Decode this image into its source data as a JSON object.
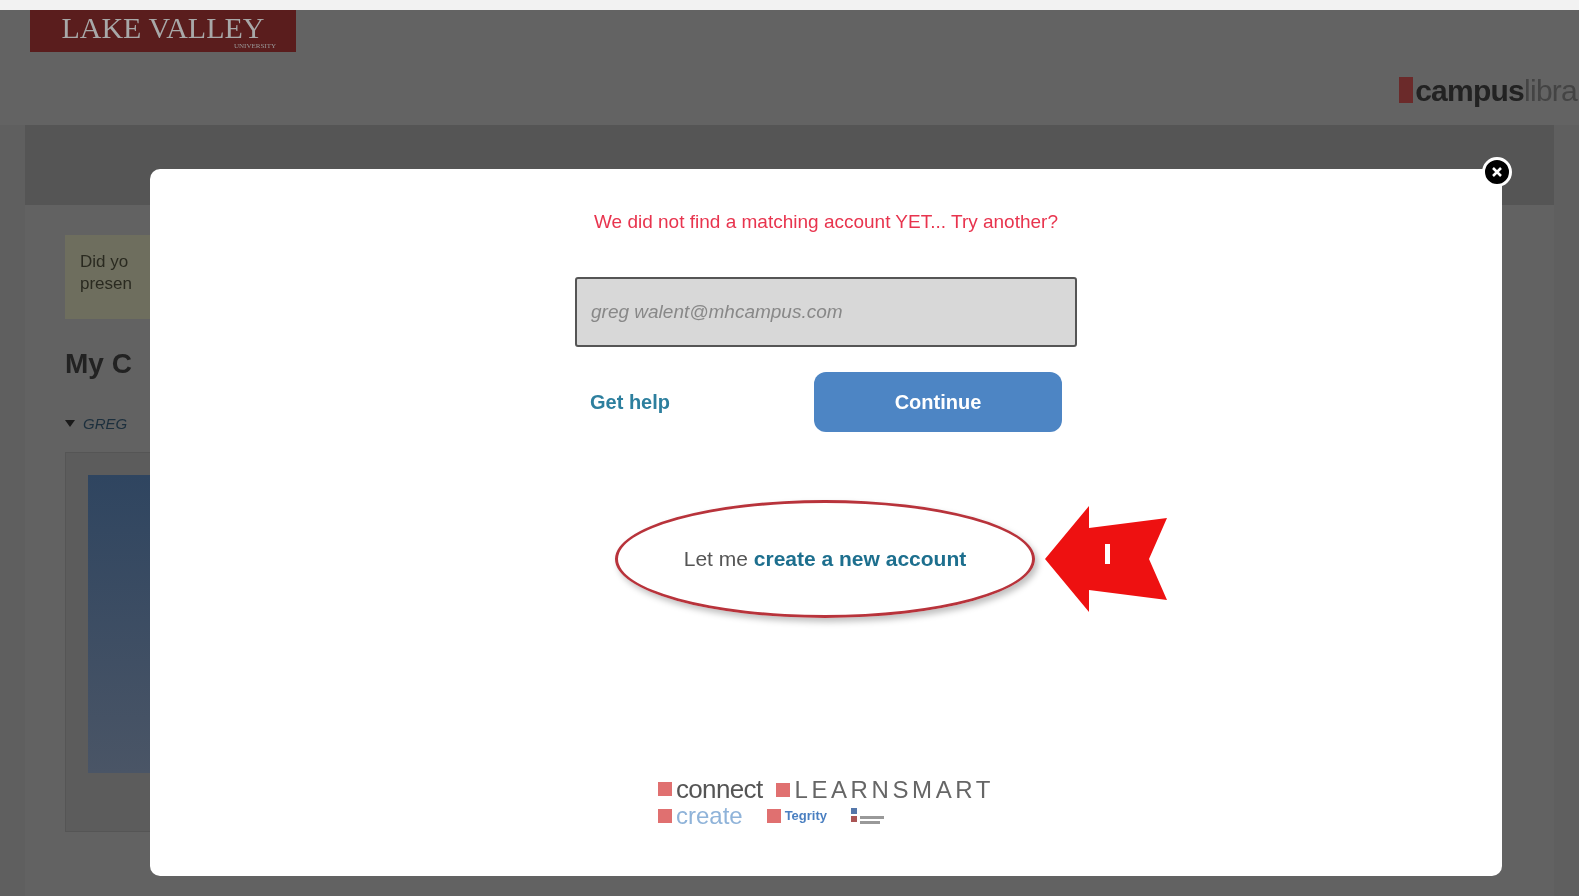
{
  "header": {
    "logo_name": "LAKE VALLEY",
    "logo_sub": "UNIVERSITY",
    "brand_main": "campus",
    "brand_rest": "libra"
  },
  "background": {
    "notice_lines": [
      "Did yo",
      "presen"
    ],
    "heading": "My C",
    "group": {
      "label": "GREG",
      "expanded": true
    }
  },
  "modal": {
    "message": "We did not find a matching account YET... Try another?",
    "email": {
      "value": "greg walent@mhcampus.com"
    },
    "get_help": "Get help",
    "continue": "Continue",
    "create_prefix": "Let me",
    "create_link": "create a new account",
    "products": [
      {
        "label": "connect",
        "kind": "connect"
      },
      {
        "label": "LEARNSMART",
        "kind": "learnsmart"
      },
      {
        "label": "create",
        "kind": "create"
      },
      {
        "label": "Tegrity",
        "kind": "tegrity"
      }
    ]
  }
}
